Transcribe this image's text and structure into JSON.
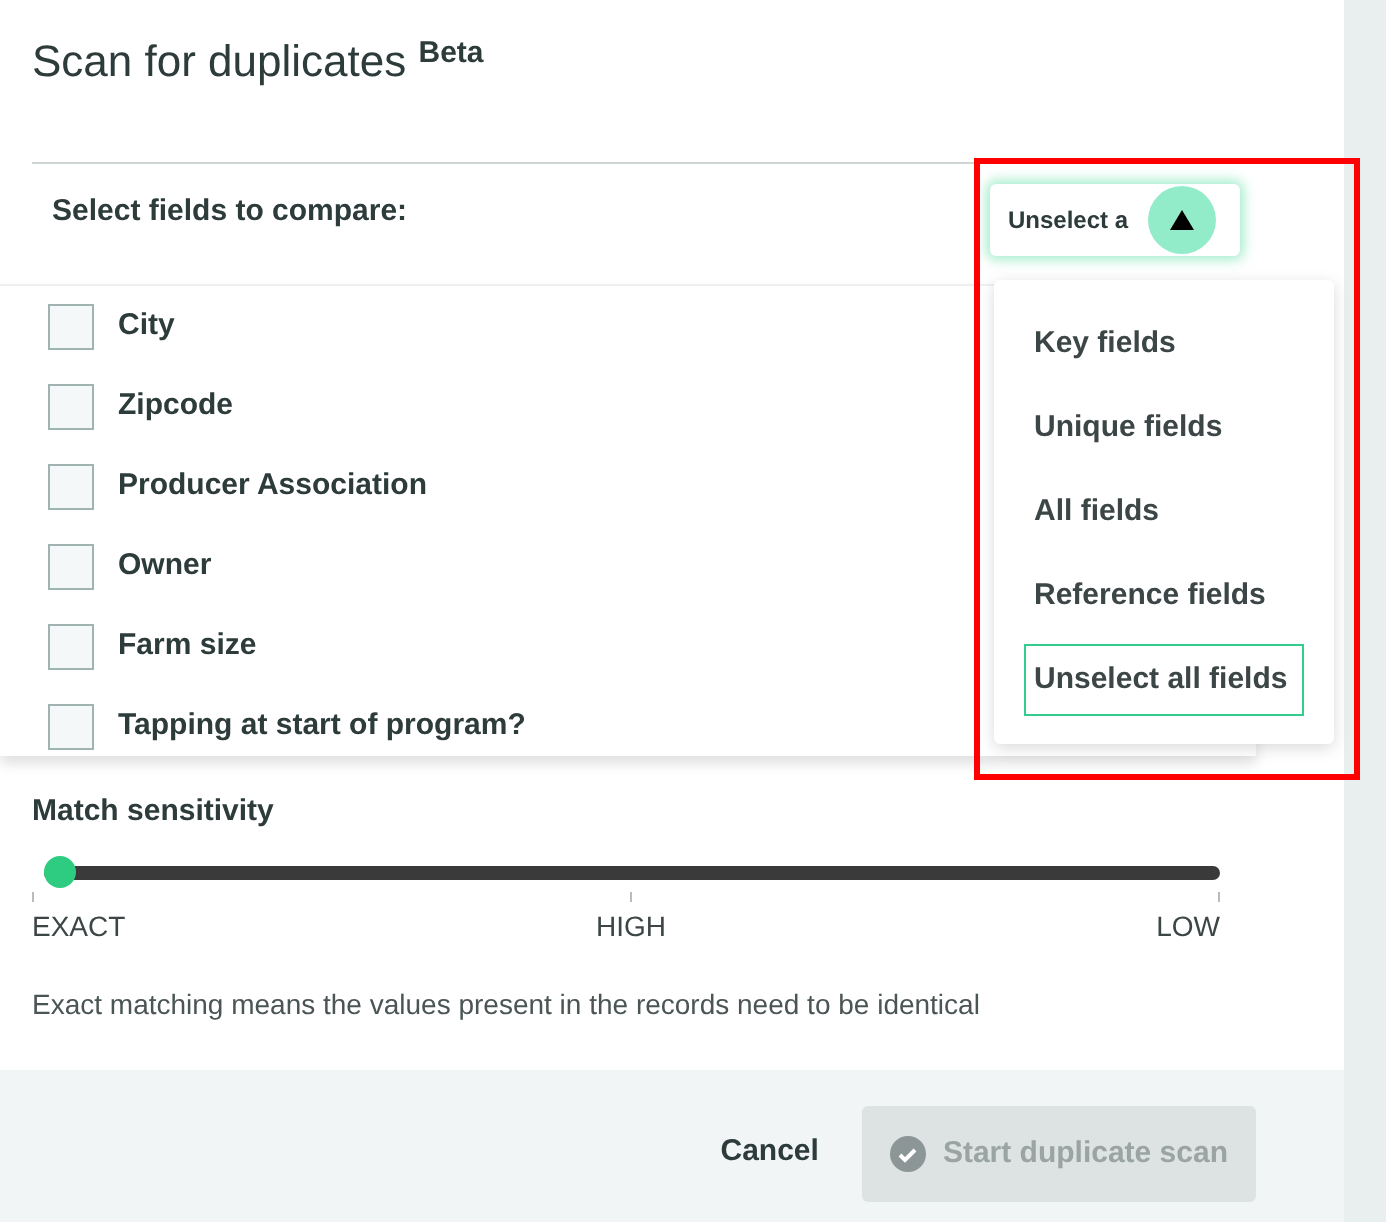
{
  "dialog": {
    "title": "Scan for duplicates",
    "badge": "Beta"
  },
  "fields": {
    "heading": "Select fields to compare:",
    "items": [
      {
        "label": "City",
        "checked": false
      },
      {
        "label": "Zipcode",
        "checked": false
      },
      {
        "label": "Producer Association",
        "checked": false
      },
      {
        "label": "Owner",
        "checked": false
      },
      {
        "label": "Farm size",
        "checked": false
      },
      {
        "label": "Tapping at start of program?",
        "checked": false
      }
    ]
  },
  "select_menu": {
    "button": "Unselect a",
    "expanded": true,
    "options": [
      {
        "label": "Key fields",
        "selected": false
      },
      {
        "label": "Unique fields",
        "selected": false
      },
      {
        "label": "All fields",
        "selected": false
      },
      {
        "label": "Reference fields",
        "selected": false
      },
      {
        "label": "Unselect all fields",
        "selected": true
      }
    ]
  },
  "sensitivity": {
    "label": "Match sensitivity",
    "level": 0,
    "ticks": [
      "EXACT",
      "HIGH",
      "LOW"
    ],
    "description": "Exact matching means the values present in the records need to be identical"
  },
  "footer": {
    "cancel": "Cancel",
    "start": "Start duplicate scan",
    "start_disabled": true
  }
}
